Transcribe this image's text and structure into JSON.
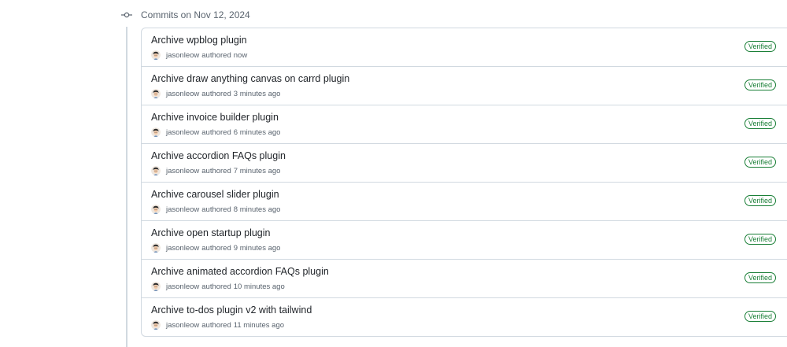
{
  "group": {
    "header": "Commits on Nov 12, 2024"
  },
  "icons": {
    "commit": "git-commit-icon",
    "avatar": "user-avatar"
  },
  "colors": {
    "verified": "#1a7f37",
    "muted_text": "#59636e",
    "border": "#d1d9e0"
  },
  "commits": [
    {
      "title": "Archive wpblog plugin",
      "author": "jasonleow",
      "verb": "authored",
      "time": "now",
      "badge": "Verified"
    },
    {
      "title": "Archive draw anything canvas on carrd plugin",
      "author": "jasonleow",
      "verb": "authored",
      "time": "3 minutes ago",
      "badge": "Verified"
    },
    {
      "title": "Archive invoice builder plugin",
      "author": "jasonleow",
      "verb": "authored",
      "time": "6 minutes ago",
      "badge": "Verified"
    },
    {
      "title": "Archive accordion FAQs plugin",
      "author": "jasonleow",
      "verb": "authored",
      "time": "7 minutes ago",
      "badge": "Verified"
    },
    {
      "title": "Archive carousel slider plugin",
      "author": "jasonleow",
      "verb": "authored",
      "time": "8 minutes ago",
      "badge": "Verified"
    },
    {
      "title": "Archive open startup plugin",
      "author": "jasonleow",
      "verb": "authored",
      "time": "9 minutes ago",
      "badge": "Verified"
    },
    {
      "title": "Archive animated accordion FAQs plugin",
      "author": "jasonleow",
      "verb": "authored",
      "time": "10 minutes ago",
      "badge": "Verified"
    },
    {
      "title": "Archive to-dos plugin v2 with tailwind",
      "author": "jasonleow",
      "verb": "authored",
      "time": "11 minutes ago",
      "badge": "Verified"
    }
  ]
}
